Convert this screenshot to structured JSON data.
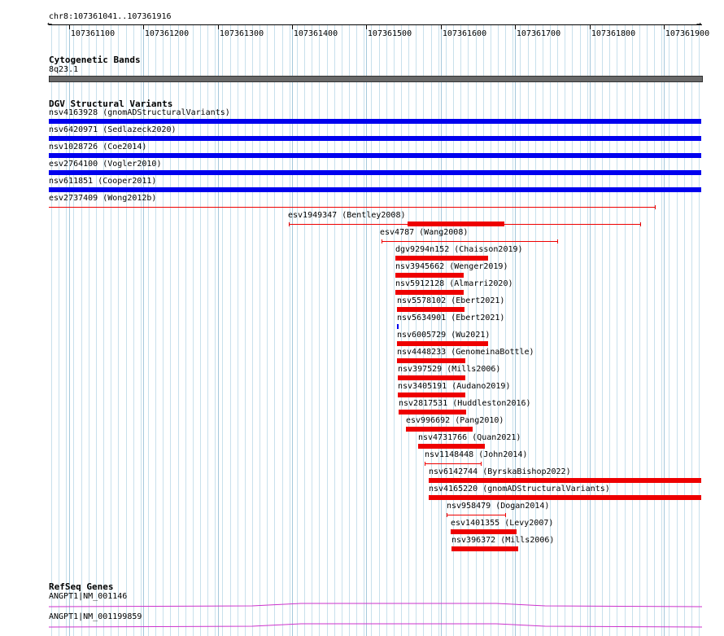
{
  "ruler": {
    "title": "chr8:107361041..107361916",
    "left_arrow": "←",
    "right_arrow": "→",
    "ticks": [
      "107361100",
      "107361200",
      "107361300",
      "107361400",
      "107361500",
      "107361600",
      "107361700",
      "107361800",
      "107361900"
    ]
  },
  "cytoband": {
    "title": "Cytogenetic Bands",
    "band": "8q23.1"
  },
  "dgv": {
    "title": "DGV Structural Variants",
    "features": [
      {
        "label": "nsv4163928 (gnomADStructuralVariants)"
      },
      {
        "label": "nsv6420971 (Sedlazeck2020)"
      },
      {
        "label": "nsv1028726 (Coe2014)"
      },
      {
        "label": "esv2764100 (Vogler2010)"
      },
      {
        "label": "nsv611851 (Cooper2011)"
      },
      {
        "label": "esv2737409 (Wong2012b)"
      },
      {
        "label": "esv1949347 (Bentley2008)"
      },
      {
        "label": "esv4787 (Wang2008)"
      },
      {
        "label": "dgv9294n152 (Chaisson2019)"
      },
      {
        "label": "nsv3945662 (Wenger2019)"
      },
      {
        "label": "nsv5912128 (Almarri2020)"
      },
      {
        "label": "nsv5578102 (Ebert2021)"
      },
      {
        "label": "nsv5634901 (Ebert2021)"
      },
      {
        "label": "nsv6005729 (Wu2021)"
      },
      {
        "label": "nsv4448233 (GenomeinaBottle)"
      },
      {
        "label": "nsv397529 (Mills2006)"
      },
      {
        "label": "nsv3405191 (Audano2019)"
      },
      {
        "label": "nsv2817531 (Huddleston2016)"
      },
      {
        "label": "esv996692 (Pang2010)"
      },
      {
        "label": "nsv4731766 (Quan2021)"
      },
      {
        "label": "nsv1148448 (John2014)"
      },
      {
        "label": "nsv6142744 (ByrskaBishop2022)"
      },
      {
        "label": "nsv4165220 (gnomADStructuralVariants)"
      },
      {
        "label": "nsv958479 (Dogan2014)"
      },
      {
        "label": "esv1401355 (Levy2007)"
      },
      {
        "label": "nsv396372 (Mills2006)"
      }
    ]
  },
  "refseq": {
    "title": "RefSeq Genes",
    "genes": [
      {
        "label": "ANGPT1|NM_001146"
      },
      {
        "label": "ANGPT1|NM_001199859"
      }
    ]
  },
  "colors": {
    "gain": "#0000ee",
    "loss": "#ee0000",
    "band": "#696969",
    "gene": "#cc33cc",
    "grid": "#add8e6"
  }
}
